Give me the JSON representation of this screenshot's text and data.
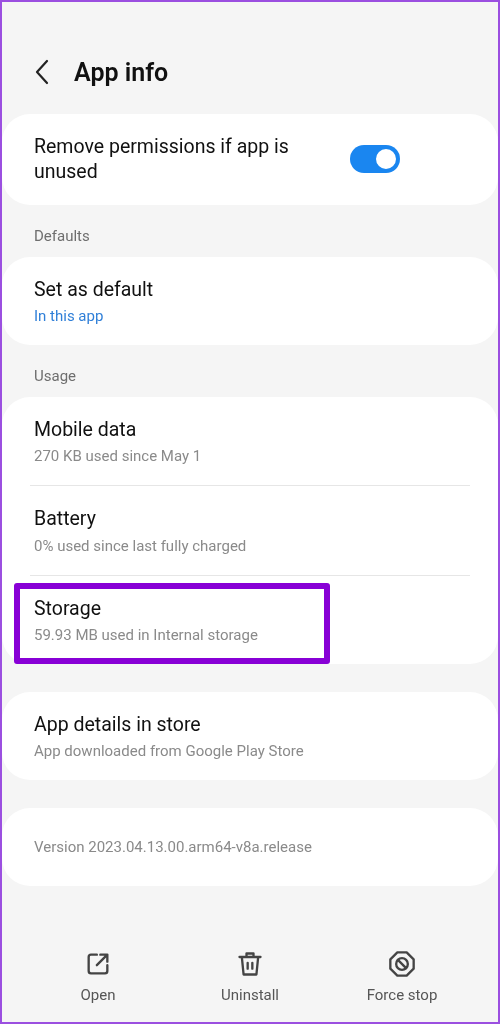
{
  "header": {
    "title": "App info"
  },
  "sections": [
    {
      "cards": [
        {
          "items": [
            {
              "kind": "toggle",
              "title": "Remove permissions if app is unused",
              "on": true
            }
          ]
        }
      ]
    },
    {
      "heading": "Defaults",
      "cards": [
        {
          "items": [
            {
              "kind": "link",
              "title": "Set as default",
              "subtitle": "In this app",
              "subtitle_link": true
            }
          ]
        }
      ]
    },
    {
      "heading": "Usage",
      "cards": [
        {
          "items": [
            {
              "kind": "link",
              "title": "Mobile data",
              "subtitle": "270 KB used since May 1",
              "highlighted": false
            },
            {
              "kind": "link",
              "title": "Battery",
              "subtitle": "0% used since last fully charged",
              "highlighted": false
            },
            {
              "kind": "link",
              "title": "Storage",
              "subtitle": "59.93 MB used in Internal storage",
              "highlighted": true
            }
          ]
        },
        {
          "items": [
            {
              "kind": "link",
              "title": "App details in store",
              "subtitle": "App downloaded from Google Play Store"
            }
          ]
        },
        {
          "items": [
            {
              "kind": "info",
              "text": "Version 2023.04.13.00.arm64-v8a.release"
            }
          ]
        }
      ]
    }
  ],
  "actions": [
    {
      "kind": "open",
      "label": "Open"
    },
    {
      "kind": "uninstall",
      "label": "Uninstall"
    },
    {
      "kind": "stop",
      "label": "Force stop"
    }
  ]
}
